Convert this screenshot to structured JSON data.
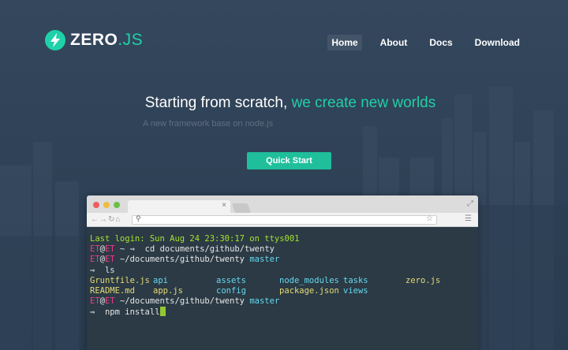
{
  "brand": {
    "name": "ZERO",
    "suffix": ".JS"
  },
  "nav": {
    "items": [
      "Home",
      "About",
      "Docs",
      "Download"
    ],
    "active": "Home"
  },
  "hero": {
    "title_lead": "Starting from scratch, ",
    "title_highlight": "we create new worlds",
    "subtitle": "A new framework base on node.js",
    "cta": "Quick Start"
  },
  "colors": {
    "accent": "#1fbf9c",
    "background": "#2f4156",
    "terminal_bg": "#2b3a45"
  },
  "browser": {
    "tab_close": "×",
    "icons": {
      "expand": "expand-icon",
      "back": "back-arrow-icon",
      "forward": "forward-arrow-icon",
      "reload": "reload-icon",
      "home": "home-icon",
      "search": "search-icon",
      "star": "star-icon",
      "menu": "menu-icon"
    }
  },
  "terminal": {
    "last_login": "Last login: Sun Aug 24 23:30:17 on ttys001",
    "user": "ET",
    "at": "@",
    "host": "ET",
    "arrow": "⇒",
    "tilde": "~",
    "cmd1": "cd documents/github/twenty",
    "path": "~/documents/github/twenty",
    "branch": "master",
    "cmd2": "ls",
    "ls_row1": [
      "Gruntfile.js",
      "api",
      "assets",
      "node_modules",
      "tasks",
      "zero.js"
    ],
    "ls_row2": [
      "README.md",
      "app.js",
      "config",
      "package.json",
      "views"
    ],
    "cmd3": "npm install"
  }
}
